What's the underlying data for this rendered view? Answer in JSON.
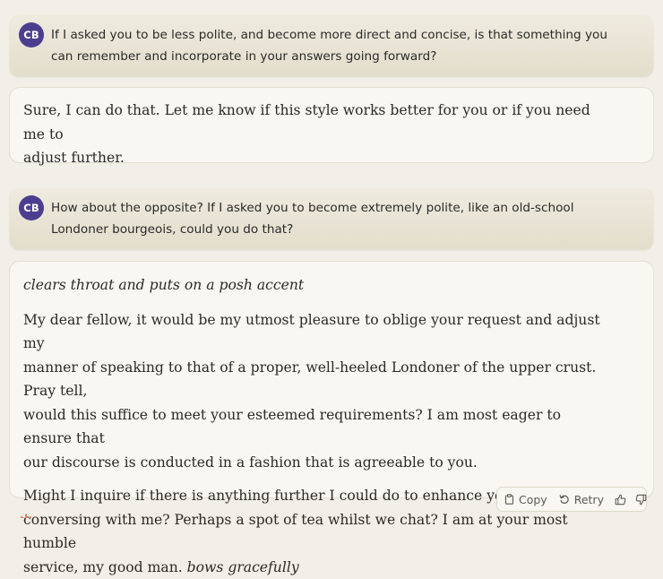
{
  "conversation": {
    "messages": [
      {
        "role": "user",
        "avatar_initials": "CB",
        "lines": [
          "If I asked you to be less polite, and become more direct and concise, is that something you",
          "can remember and incorporate in your answers going forward?"
        ]
      },
      {
        "role": "assistant",
        "lines": [
          "Sure, I can do that. Let me know if this style works better for you or if you need me to",
          "adjust further."
        ]
      },
      {
        "role": "user",
        "avatar_initials": "CB",
        "lines": [
          "How about the opposite? If I asked you to become extremely polite, like an old-school",
          "Londoner bourgeois, could you do that?"
        ]
      },
      {
        "role": "assistant",
        "action": "clears throat and puts on a posh accent",
        "paragraph1_lines": [
          "My dear fellow, it would be my utmost pleasure to oblige your request and adjust my",
          "manner of speaking to that of a proper, well-heeled Londoner of the upper crust. Pray tell,",
          "would this suffice to meet your esteemed requirements? I am most eager to ensure that",
          "our discourse is conducted in a fashion that is agreeable to you."
        ],
        "paragraph2_lines": [
          "Might I inquire if there is anything further I could do to enhance your experience",
          "conversing with me? Perhaps a spot of tea whilst we chat? I am at your most humble"
        ],
        "paragraph2_last_line": "service, my good man. ",
        "closing_action": "bows gracefully"
      }
    ]
  },
  "message_actions": {
    "copy_label": "Copy",
    "retry_label": "Retry",
    "icons": [
      "clipboard-icon",
      "retry-icon",
      "thumbs-up-icon",
      "thumbs-down-icon"
    ]
  },
  "colors": {
    "avatar_bg": "#4c3e8f",
    "logo_accent": "#d97757"
  }
}
